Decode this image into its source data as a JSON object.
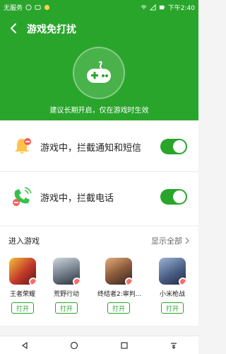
{
  "status": {
    "carrier": "无服务",
    "time": "下午2:40"
  },
  "header": {
    "title": "游戏免打扰",
    "subtitle": "建议长期开启，仅在游戏时生效"
  },
  "settings": [
    {
      "label": "游戏中，拦截通知和短信",
      "enabled": true,
      "icon": "bell-icon"
    },
    {
      "label": "游戏中，拦截电话",
      "enabled": true,
      "icon": "phone-icon"
    }
  ],
  "games": {
    "heading": "进入游戏",
    "show_all": "显示全部",
    "items": [
      {
        "name": "王者荣耀",
        "button": "打开"
      },
      {
        "name": "荒野行动",
        "button": "打开"
      },
      {
        "name": "终结者2:审判...",
        "button": "打开"
      },
      {
        "name": "小米枪战",
        "button": "打开"
      }
    ]
  },
  "colors": {
    "accent": "#2aa52c"
  }
}
